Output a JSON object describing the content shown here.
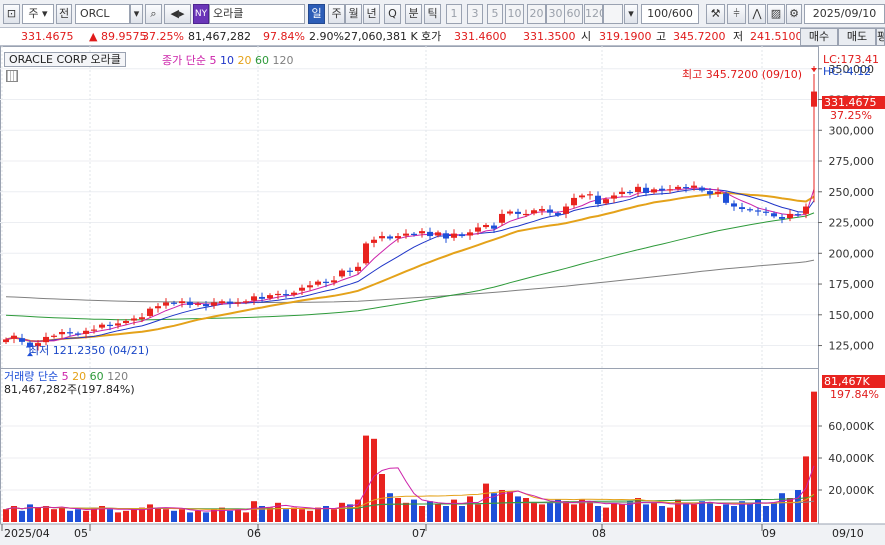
{
  "toolbar": {
    "market_type": "주",
    "market_sub": "전",
    "symbol": "ORCL",
    "exchange_badge": "NY",
    "stock_name": "오라클",
    "periods": [
      "일",
      "주",
      "월",
      "년",
      "Q",
      "분",
      "틱"
    ],
    "selected_period": "일",
    "intervals": [
      "1",
      "3",
      "5",
      "10",
      "20",
      "30",
      "60",
      "120"
    ],
    "count_value": "100",
    "count_total": "/600",
    "date": "2025/09/10"
  },
  "infobar": {
    "price": "331.4675",
    "change": "▲ 89.9575",
    "change_pct": "37.25%",
    "volume": "81,467,282",
    "volume_pct": "97.84%",
    "turnover_pct": "2.90%",
    "trade_amount": "27,060,381 K",
    "quote_label": "호가",
    "bid": "331.4600",
    "ask": "331.3500",
    "open_label": "시",
    "open": "319.1900",
    "high_label": "고",
    "high": "345.7200",
    "low_label": "저",
    "low": "241.5100",
    "buy_label": "매수",
    "sell_label": "매도",
    "avg_label": "평"
  },
  "price_panel": {
    "name_box": "ORACLE CORP  오라클",
    "indicator_label": "종가 단순",
    "ma_periods": [
      "5",
      "10",
      "20",
      "60",
      "120"
    ],
    "ma_colors": [
      "#cc22aa",
      "#1f35c8",
      "#e4a21a",
      "#2e9a3a",
      "#808080"
    ],
    "lc_label": "LC:173.41",
    "hc_label": "HC:-4.12",
    "high_annotation": "최고 345.7200 (09/10)",
    "low_annotation": "최저 121.2350 (04/21)",
    "price_tag": "331.4675",
    "pct_tag": "37.25%",
    "y_ticks": [
      "350,000",
      "325,000",
      "300,000",
      "275,000",
      "250,000",
      "225,000",
      "200,000",
      "175,000",
      "150,000",
      "125,000"
    ]
  },
  "volume_panel": {
    "indicator_label": "거래량 단순",
    "ma_periods": [
      "5",
      "20",
      "60",
      "120"
    ],
    "volume_text": "81,467,282주(197.84%)",
    "vol_tag": "81,467K",
    "vol_pct_tag": "197.84%",
    "y_ticks": [
      "60,000K",
      "40,000K",
      "20,000K"
    ]
  },
  "x_axis": {
    "labels": [
      "2025/04",
      "05",
      "06",
      "07",
      "08",
      "09",
      "09/10"
    ]
  },
  "colors": {
    "up": "#e8231f",
    "down": "#1e4fd8",
    "ma20": "#e4a21a",
    "ma60": "#2e9a3a",
    "ma120": "#888888"
  },
  "chart_data": {
    "type": "candlestick",
    "x": [
      "04/15",
      "04/16",
      "04/17",
      "04/21",
      "04/22",
      "04/23",
      "04/24",
      "04/25",
      "04/28",
      "04/29",
      "04/30",
      "05/01",
      "05/02",
      "05/05",
      "05/06",
      "05/07",
      "05/08",
      "05/09",
      "05/12",
      "05/13",
      "05/14",
      "05/15",
      "05/16",
      "05/19",
      "05/20",
      "05/21",
      "05/22",
      "05/23",
      "05/27",
      "05/28",
      "05/29",
      "05/30",
      "06/02",
      "06/03",
      "06/04",
      "06/05",
      "06/06",
      "06/09",
      "06/10",
      "06/11",
      "06/12",
      "06/13",
      "06/16",
      "06/17",
      "06/18",
      "06/20",
      "06/23",
      "06/24",
      "06/25",
      "06/26",
      "06/27",
      "06/30",
      "07/01",
      "07/02",
      "07/03",
      "07/07",
      "07/08",
      "07/09",
      "07/10",
      "07/11",
      "07/14",
      "07/15",
      "07/16",
      "07/17",
      "07/18",
      "07/21",
      "07/22",
      "07/23",
      "07/24",
      "07/25",
      "07/28",
      "07/29",
      "07/30",
      "07/31",
      "08/01",
      "08/04",
      "08/05",
      "08/06",
      "08/07",
      "08/08",
      "08/11",
      "08/12",
      "08/13",
      "08/14",
      "08/15",
      "08/18",
      "08/19",
      "08/20",
      "08/21",
      "08/22",
      "08/25",
      "08/26",
      "08/27",
      "08/28",
      "08/29",
      "09/02",
      "09/03",
      "09/04",
      "09/05",
      "09/08",
      "09/09",
      "09/10"
    ],
    "close": [
      130,
      133,
      128,
      124,
      127,
      132,
      133,
      136,
      135,
      134,
      137,
      138,
      142,
      141,
      143,
      145,
      147,
      148,
      155,
      157,
      160,
      159,
      161,
      158,
      159,
      157,
      160,
      161,
      159,
      160,
      161,
      165,
      163,
      166,
      167,
      166,
      168,
      172,
      174,
      177,
      176,
      178,
      186,
      185,
      189,
      208,
      211,
      214,
      212,
      214,
      216,
      215,
      218,
      214,
      217,
      212,
      216,
      214,
      217,
      221,
      223,
      220,
      232,
      234,
      232,
      232,
      235,
      236,
      233,
      231,
      238,
      245,
      247,
      248,
      240,
      244,
      247,
      250,
      249,
      254,
      249,
      252,
      251,
      252,
      254,
      253,
      255,
      251,
      248,
      250,
      241,
      238,
      236,
      235,
      234,
      233,
      230,
      228,
      232,
      231,
      238,
      331.47
    ],
    "volume_k": [
      8,
      10,
      7,
      11,
      9,
      10,
      8,
      9,
      7,
      8,
      7,
      9,
      10,
      8,
      6,
      7,
      8,
      9,
      11,
      9,
      8,
      7,
      8,
      6,
      7,
      6,
      8,
      9,
      7,
      8,
      6,
      13,
      10,
      9,
      12,
      8,
      9,
      8,
      7,
      9,
      10,
      8,
      12,
      11,
      14,
      54,
      52,
      30,
      18,
      15,
      12,
      14,
      10,
      13,
      11,
      10,
      14,
      10,
      16,
      11,
      24,
      18,
      20,
      19,
      16,
      15,
      12,
      11,
      12,
      14,
      13,
      11,
      14,
      13,
      10,
      9,
      12,
      11,
      13,
      15,
      11,
      12,
      10,
      9,
      14,
      12,
      11,
      13,
      12,
      10,
      11,
      10,
      13,
      12,
      14,
      10,
      12,
      18,
      15,
      20,
      41,
      81.47
    ],
    "price_ylim": [
      110000,
      362000
    ],
    "volume_ylim": [
      0,
      90000
    ],
    "high": {
      "value": 345.72,
      "date": "09/10"
    },
    "low": {
      "value": 121.235,
      "date": "04/21"
    }
  }
}
